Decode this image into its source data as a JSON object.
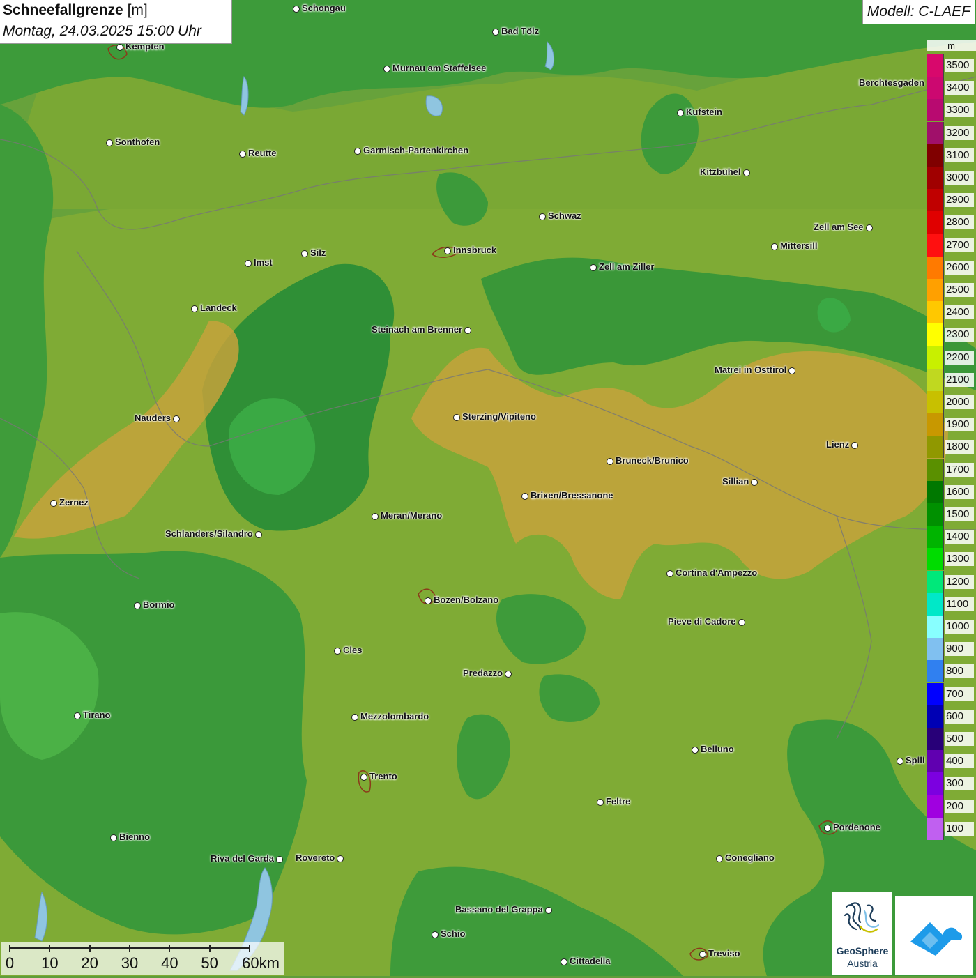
{
  "header": {
    "title_bold": "Schneefallgrenze",
    "title_unit": " [m]",
    "subtitle": "Montag, 24.03.2025 15:00 Uhr",
    "model": "Modell: C-LAEF"
  },
  "legend": {
    "unit": "m",
    "items": [
      {
        "label": "3500",
        "color": "#d8086c"
      },
      {
        "label": "3400",
        "color": "#cc0870"
      },
      {
        "label": "3300",
        "color": "#b80a70"
      },
      {
        "label": "3200",
        "color": "#a0106a"
      },
      {
        "label": "3100",
        "color": "#800000"
      },
      {
        "label": "3000",
        "color": "#a00000"
      },
      {
        "label": "2900",
        "color": "#c00000"
      },
      {
        "label": "2800",
        "color": "#e00000"
      },
      {
        "label": "2700",
        "color": "#ff1010"
      },
      {
        "label": "2600",
        "color": "#ff7a00"
      },
      {
        "label": "2500",
        "color": "#ffa000"
      },
      {
        "label": "2400",
        "color": "#ffc800"
      },
      {
        "label": "2300",
        "color": "#ffff00"
      },
      {
        "label": "2200",
        "color": "#c8f000"
      },
      {
        "label": "2100",
        "color": "#c0d820"
      },
      {
        "label": "2000",
        "color": "#c8c000"
      },
      {
        "label": "1900",
        "color": "#c89800"
      },
      {
        "label": "1800",
        "color": "#909800"
      },
      {
        "label": "1700",
        "color": "#5a9000"
      },
      {
        "label": "1600",
        "color": "#007800"
      },
      {
        "label": "1500",
        "color": "#009000"
      },
      {
        "label": "1400",
        "color": "#00b400"
      },
      {
        "label": "1300",
        "color": "#00dc00"
      },
      {
        "label": "1200",
        "color": "#00e87a"
      },
      {
        "label": "1100",
        "color": "#00e8c8"
      },
      {
        "label": "1000",
        "color": "#88ffff"
      },
      {
        "label": "900",
        "color": "#80c0f0"
      },
      {
        "label": "800",
        "color": "#3080f0"
      },
      {
        "label": "700",
        "color": "#0000ff"
      },
      {
        "label": "600",
        "color": "#0000b4"
      },
      {
        "label": "500",
        "color": "#280078"
      },
      {
        "label": "400",
        "color": "#6000b0"
      },
      {
        "label": "300",
        "color": "#7c00e0"
      },
      {
        "label": "200",
        "color": "#a000e0"
      },
      {
        "label": "100",
        "color": "#c060f0"
      }
    ]
  },
  "scalebar": {
    "labels": [
      "0",
      "10",
      "20",
      "30",
      "40",
      "50",
      "60km"
    ]
  },
  "logos": {
    "geosphere_name": "GeoSphere",
    "geosphere_sub": "Austria"
  },
  "cities": [
    {
      "name": "Schongau"
    },
    {
      "name": "Kempten"
    },
    {
      "name": "Bad Tölz"
    },
    {
      "name": "Murnau am Staffelsee"
    },
    {
      "name": "Berchtesgaden"
    },
    {
      "name": "Kufstein"
    },
    {
      "name": "Sonthofen"
    },
    {
      "name": "Reutte"
    },
    {
      "name": "Garmisch-Partenkirchen"
    },
    {
      "name": "Kitzbühel"
    },
    {
      "name": "Schwaz"
    },
    {
      "name": "Zell am See"
    },
    {
      "name": "Innsbruck"
    },
    {
      "name": "Mittersill"
    },
    {
      "name": "Imst"
    },
    {
      "name": "Silz"
    },
    {
      "name": "Zell am Ziller"
    },
    {
      "name": "Landeck"
    },
    {
      "name": "Steinach am Brenner"
    },
    {
      "name": "Matrei in Osttirol"
    },
    {
      "name": "Nauders"
    },
    {
      "name": "Sterzing/Vipiteno"
    },
    {
      "name": "Lienz"
    },
    {
      "name": "Bruneck/Brunico"
    },
    {
      "name": "Sillian"
    },
    {
      "name": "Zernez"
    },
    {
      "name": "Brixen/Bressanone"
    },
    {
      "name": "Meran/Merano"
    },
    {
      "name": "Schlanders/Silandro"
    },
    {
      "name": "Cortina d'Ampezzo"
    },
    {
      "name": "Bormio"
    },
    {
      "name": "Bozen/Bolzano"
    },
    {
      "name": "Pieve di Cadore"
    },
    {
      "name": "Cles"
    },
    {
      "name": "Predazzo"
    },
    {
      "name": "Tirano"
    },
    {
      "name": "Mezzolombardo"
    },
    {
      "name": "Belluno"
    },
    {
      "name": "Spili"
    },
    {
      "name": "Trento"
    },
    {
      "name": "Feltre"
    },
    {
      "name": "Pordenone"
    },
    {
      "name": "Bienno"
    },
    {
      "name": "Riva del Garda"
    },
    {
      "name": "Rovereto"
    },
    {
      "name": "Conegliano"
    },
    {
      "name": "Bassano del Grappa"
    },
    {
      "name": "Schio"
    },
    {
      "name": "Treviso"
    },
    {
      "name": "Cittadella"
    }
  ]
}
